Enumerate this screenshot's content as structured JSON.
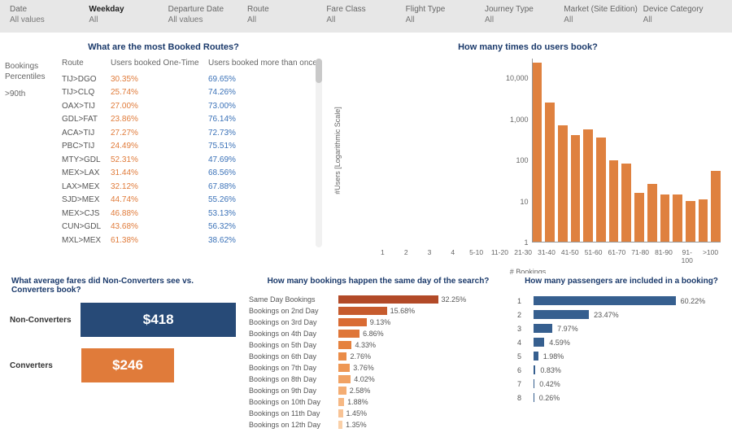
{
  "filters": [
    {
      "name": "Date",
      "value": "All values",
      "active": false
    },
    {
      "name": "Weekday",
      "value": "All",
      "active": true
    },
    {
      "name": "Departure Date",
      "value": "All values",
      "active": false
    },
    {
      "name": "Route",
      "value": "All",
      "active": false
    },
    {
      "name": "Fare Class",
      "value": "All",
      "active": false
    },
    {
      "name": "Flight Type",
      "value": "All",
      "active": false
    },
    {
      "name": "Journey Type",
      "value": "All",
      "active": false
    },
    {
      "name": "Market (Site Edition)",
      "value": "All",
      "active": false
    },
    {
      "name": "Device Category",
      "value": "All",
      "active": false
    }
  ],
  "panel1": {
    "title": "What are the most Booked Routes?",
    "leftHdr1": "Bookings",
    "leftHdr2": "Percentiles",
    "leftVal": ">90th",
    "col1": "Route",
    "col2": "Users booked One-Time",
    "col3": "Users booked more than once",
    "rows": [
      {
        "rt": "TIJ>DGO",
        "v1": "30.35%",
        "v2": "69.65%"
      },
      {
        "rt": "TIJ>CLQ",
        "v1": "25.74%",
        "v2": "74.26%"
      },
      {
        "rt": "OAX>TIJ",
        "v1": "27.00%",
        "v2": "73.00%"
      },
      {
        "rt": "GDL>FAT",
        "v1": "23.86%",
        "v2": "76.14%"
      },
      {
        "rt": "ACA>TIJ",
        "v1": "27.27%",
        "v2": "72.73%"
      },
      {
        "rt": "PBC>TIJ",
        "v1": "24.49%",
        "v2": "75.51%"
      },
      {
        "rt": "MTY>GDL",
        "v1": "52.31%",
        "v2": "47.69%"
      },
      {
        "rt": "MEX>LAX",
        "v1": "31.44%",
        "v2": "68.56%"
      },
      {
        "rt": "LAX>MEX",
        "v1": "32.12%",
        "v2": "67.88%"
      },
      {
        "rt": "SJD>MEX",
        "v1": "44.74%",
        "v2": "55.26%"
      },
      {
        "rt": "MEX>CJS",
        "v1": "46.88%",
        "v2": "53.13%"
      },
      {
        "rt": "CUN>GDL",
        "v1": "43.68%",
        "v2": "56.32%"
      },
      {
        "rt": "MXL>MEX",
        "v1": "61.38%",
        "v2": "38.62%"
      }
    ]
  },
  "panel2": {
    "title": "How many times do users book?",
    "ylabel": "#Users [Logarithmic Scale]",
    "xlabel": "# Bookings",
    "yticks": [
      "1",
      "10",
      "100",
      "1,000",
      "10,000"
    ]
  },
  "panel3": {
    "title": "What average fares did Non-Converters see vs. Converters book?",
    "rows": [
      {
        "label": "Non-Converters",
        "value": "$418",
        "color": "#274a77",
        "width": 192
      },
      {
        "label": "Converters",
        "value": "$246",
        "color": "#e07b3a",
        "width": 114
      }
    ]
  },
  "panel4": {
    "title": "How many bookings happen the same day of the search?",
    "rows": [
      {
        "label": "Same Day Bookings",
        "pct": "32.25%",
        "v": 32.25,
        "color": "#b24a28"
      },
      {
        "label": "Bookings on 2nd Day",
        "pct": "15.68%",
        "v": 15.68,
        "color": "#c65b2e"
      },
      {
        "label": "Bookings on 3rd Day",
        "pct": "9.13%",
        "v": 9.13,
        "color": "#d96b33"
      },
      {
        "label": "Bookings on 4th Day",
        "pct": "6.86%",
        "v": 6.86,
        "color": "#df7638"
      },
      {
        "label": "Bookings on 5th Day",
        "pct": "4.33%",
        "v": 4.33,
        "color": "#e5813e"
      },
      {
        "label": "Bookings on 6th Day",
        "pct": "2.76%",
        "v": 2.76,
        "color": "#ea8c48"
      },
      {
        "label": "Bookings on 7th Day",
        "pct": "3.76%",
        "v": 3.76,
        "color": "#ee9754"
      },
      {
        "label": "Bookings on 8th Day",
        "pct": "4.02%",
        "v": 4.02,
        "color": "#f1a263"
      },
      {
        "label": "Bookings on 9th Day",
        "pct": "2.58%",
        "v": 2.58,
        "color": "#f4ad73"
      },
      {
        "label": "Bookings on 10th Day",
        "pct": "1.88%",
        "v": 1.88,
        "color": "#f6b884"
      },
      {
        "label": "Bookings on 11th Day",
        "pct": "1.45%",
        "v": 1.45,
        "color": "#f8c395"
      },
      {
        "label": "Bookings on 12th Day",
        "pct": "1.35%",
        "v": 1.35,
        "color": "#fad0a8"
      }
    ]
  },
  "panel5": {
    "title": "How many passengers are included in a booking?",
    "rows": [
      {
        "label": "1",
        "pct": "60.22%",
        "v": 60.22
      },
      {
        "label": "2",
        "pct": "23.47%",
        "v": 23.47
      },
      {
        "label": "3",
        "pct": "7.97%",
        "v": 7.97
      },
      {
        "label": "4",
        "pct": "4.59%",
        "v": 4.59
      },
      {
        "label": "5",
        "pct": "1.98%",
        "v": 1.98
      },
      {
        "label": "6",
        "pct": "0.83%",
        "v": 0.83
      },
      {
        "label": "7",
        "pct": "0.42%",
        "v": 0.42
      },
      {
        "label": "8",
        "pct": "0.26%",
        "v": 0.26
      }
    ]
  },
  "chart_data": [
    {
      "type": "bar",
      "title": "How many times do users book?",
      "xlabel": "# Bookings",
      "ylabel": "#Users [Logarithmic Scale]",
      "yscale": "log",
      "ylim": [
        1,
        30000
      ],
      "categories": [
        "1",
        "2",
        "3",
        "4",
        "5-10",
        "11-20",
        "21-30",
        "31-40",
        "41-50",
        "51-60",
        "61-70",
        "71-80",
        "81-90",
        "91-100",
        ">100"
      ],
      "values": [
        24000,
        2500,
        700,
        400,
        550,
        360,
        100,
        80,
        16,
        26,
        14,
        14,
        10,
        11,
        55
      ]
    },
    {
      "type": "bar",
      "title": "What average fares did Non-Converters see vs. Converters book?",
      "orientation": "horizontal",
      "categories": [
        "Non-Converters",
        "Converters"
      ],
      "values": [
        418,
        246
      ]
    },
    {
      "type": "bar",
      "title": "How many bookings happen the same day of the search?",
      "orientation": "horizontal",
      "categories": [
        "Same Day Bookings",
        "Bookings on 2nd Day",
        "Bookings on 3rd Day",
        "Bookings on 4th Day",
        "Bookings on 5th Day",
        "Bookings on 6th Day",
        "Bookings on 7th Day",
        "Bookings on 8th Day",
        "Bookings on 9th Day",
        "Bookings on 10th Day",
        "Bookings on 11th Day",
        "Bookings on 12th Day"
      ],
      "values": [
        32.25,
        15.68,
        9.13,
        6.86,
        4.33,
        2.76,
        3.76,
        4.02,
        2.58,
        1.88,
        1.45,
        1.35
      ]
    },
    {
      "type": "bar",
      "title": "How many passengers are included in a booking?",
      "orientation": "horizontal",
      "categories": [
        "1",
        "2",
        "3",
        "4",
        "5",
        "6",
        "7",
        "8"
      ],
      "values": [
        60.22,
        23.47,
        7.97,
        4.59,
        1.98,
        0.83,
        0.42,
        0.26
      ]
    },
    {
      "type": "table",
      "title": "What are the most Booked Routes?",
      "columns": [
        "Route",
        "Users booked One-Time",
        "Users booked more than once"
      ],
      "rows": [
        [
          "TIJ>DGO",
          30.35,
          69.65
        ],
        [
          "TIJ>CLQ",
          25.74,
          74.26
        ],
        [
          "OAX>TIJ",
          27.0,
          73.0
        ],
        [
          "GDL>FAT",
          23.86,
          76.14
        ],
        [
          "ACA>TIJ",
          27.27,
          72.73
        ],
        [
          "PBC>TIJ",
          24.49,
          75.51
        ],
        [
          "MTY>GDL",
          52.31,
          47.69
        ],
        [
          "MEX>LAX",
          31.44,
          68.56
        ],
        [
          "LAX>MEX",
          32.12,
          67.88
        ],
        [
          "SJD>MEX",
          44.74,
          55.26
        ],
        [
          "MEX>CJS",
          46.88,
          53.13
        ],
        [
          "CUN>GDL",
          43.68,
          56.32
        ],
        [
          "MXL>MEX",
          61.38,
          38.62
        ]
      ]
    }
  ]
}
